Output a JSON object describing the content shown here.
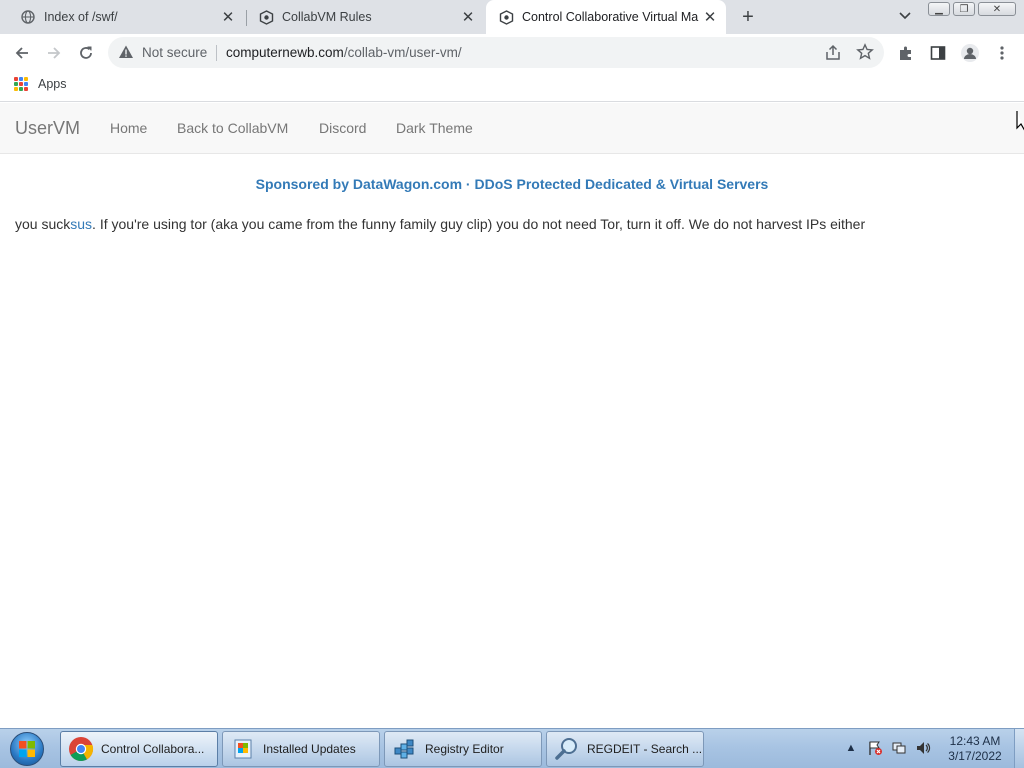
{
  "browser": {
    "tabs": [
      {
        "title": "Index of /swf/",
        "icon": "globe-icon",
        "active": false
      },
      {
        "title": "CollabVM Rules",
        "icon": "collabvm-icon",
        "active": false
      },
      {
        "title": "Control Collaborative Virtual Ma",
        "icon": "collabvm-icon",
        "active": true
      }
    ],
    "address": {
      "security_label": "Not secure",
      "host": "computernewb.com",
      "path": "/collab-vm/user-vm/"
    },
    "bookmarks": {
      "apps_label": "Apps"
    }
  },
  "page": {
    "brand": "UserVM",
    "nav": [
      "Home",
      "Back to CollabVM",
      "Discord",
      "Dark Theme"
    ],
    "sponsor": "Sponsored by DataWagon.com · DDoS Protected Dedicated & Virtual Servers",
    "message": {
      "before": "you suck",
      "link": "sus",
      "after": ". If you're using tor (aka you came from the funny family guy clip) you do not need Tor, turn it off. We do not harvest IPs either"
    }
  },
  "taskbar": {
    "tasks": [
      {
        "label": "Control Collabora...",
        "icon": "chrome-icon",
        "active": true
      },
      {
        "label": "Installed Updates",
        "icon": "installed-updates-icon",
        "active": false
      },
      {
        "label": "Registry Editor",
        "icon": "registry-editor-icon",
        "active": false
      },
      {
        "label": "REGDEIT - Search ...",
        "icon": "search-magnifier-icon",
        "active": false
      }
    ],
    "clock": {
      "time": "12:43 AM",
      "date": "3/17/2022"
    }
  },
  "colors": {
    "link": "#337ab7",
    "nav_text": "#777777",
    "tab_strip": "#dee1e6",
    "taskbar": "#a8c4e3"
  }
}
